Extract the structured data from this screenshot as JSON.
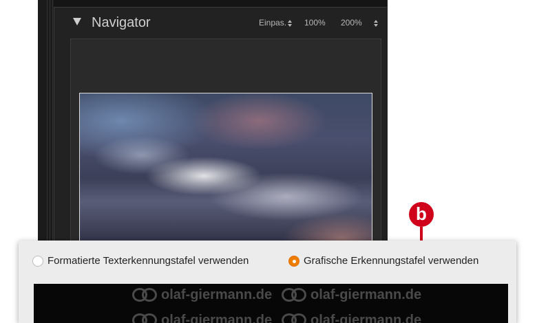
{
  "navigator": {
    "title": "Navigator",
    "zoom_options": [
      "Einpas.",
      "100%",
      "200%"
    ]
  },
  "callout": {
    "label": "b",
    "color": "#d0021b"
  },
  "identity_plate": {
    "options": [
      {
        "label": "Formatierte Texterkennungstafel verwenden",
        "selected": false
      },
      {
        "label": "Grafische Erkennungstafel verwenden",
        "selected": true
      }
    ],
    "accent_color": "#ef7d00",
    "watermark_text": [
      "olaf-giermann.de",
      "olaf-giermann.de",
      "olaf-giermann.de",
      "olaf-giermann.de"
    ]
  }
}
